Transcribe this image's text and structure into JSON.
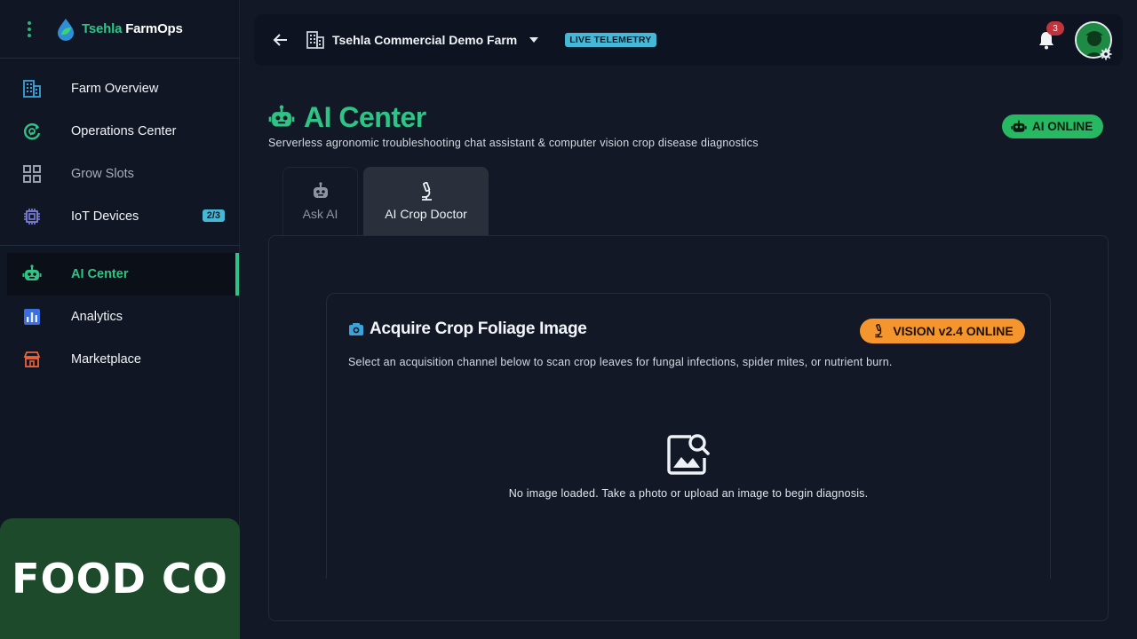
{
  "sidebar": {
    "brand_part1": "Tsehla",
    "brand_part2": "FarmOps",
    "menu_icon": "kebab-menu-icon",
    "items": [
      {
        "label": "Farm Overview",
        "icon": "building-icon"
      },
      {
        "label": "Operations Center",
        "icon": "operations-icon"
      },
      {
        "label": "Grow Slots",
        "icon": "grid-icon"
      },
      {
        "label": "IoT Devices",
        "icon": "chip-icon",
        "badge": "2/3"
      },
      {
        "label": "AI Center",
        "icon": "robot-icon",
        "active": true
      },
      {
        "label": "Analytics",
        "icon": "chart-icon"
      },
      {
        "label": "Marketplace",
        "icon": "store-icon"
      }
    ],
    "footer_logo": "FOOD CO"
  },
  "topbar": {
    "farm_name": "Tsehla Commercial Demo Farm",
    "status_badge": "LIVE TELEMETRY",
    "notification_count": "3"
  },
  "page": {
    "title": "AI Center",
    "subtitle": "Serverless agronomic troubleshooting chat assistant & computer vision crop disease diagnostics",
    "status": "AI ONLINE"
  },
  "tabs": [
    {
      "label": "Ask AI",
      "icon": "robot-icon",
      "active": false
    },
    {
      "label": "AI Crop Doctor",
      "icon": "microscope-icon",
      "active": true
    }
  ],
  "card": {
    "title": "Acquire Crop Foliage Image",
    "badge": "VISION v2.4 ONLINE",
    "description": "Select an acquisition channel below to scan crop leaves for fungal infections, spider mites, or nutrient burn.",
    "empty_text": "No image loaded. Take a photo or upload an image to begin diagnosis."
  },
  "colors": {
    "accent": "#2fc486",
    "telemetry": "#47b7d6",
    "vision": "#f4952e",
    "background": "#121826"
  }
}
